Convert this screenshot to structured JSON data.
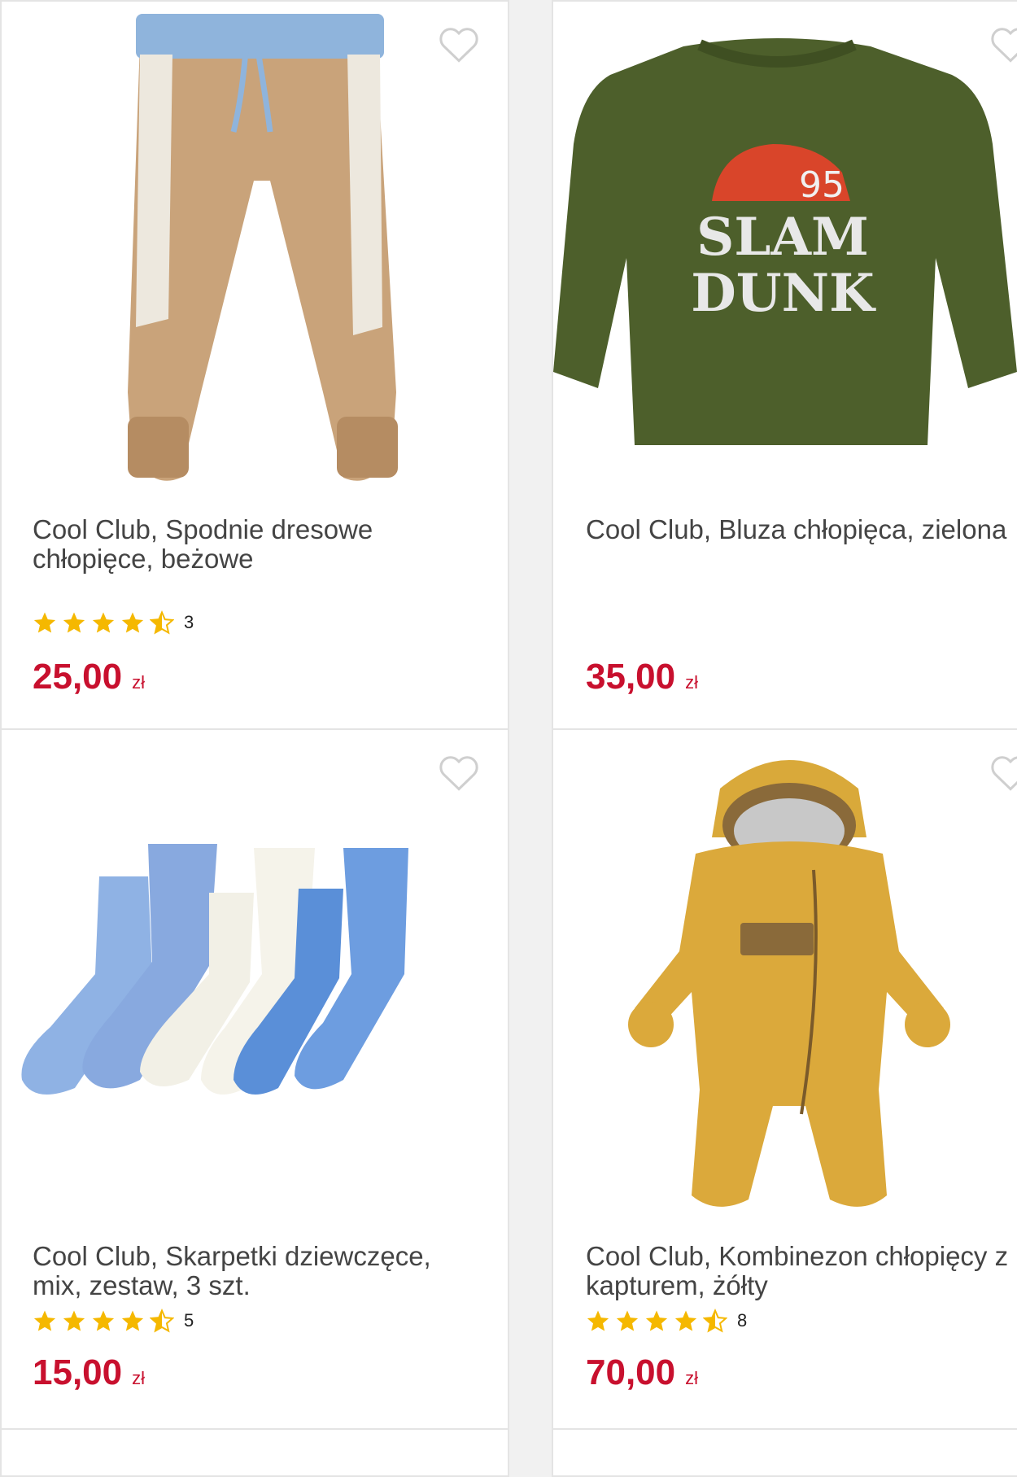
{
  "products": [
    {
      "title": "Cool Club, Spodnie dresowe chłopięce, beżowe",
      "rating": 4.5,
      "rating_count": "3",
      "price": "25,00",
      "currency": "zł",
      "image": "beige-pants"
    },
    {
      "title": "Cool Club, Bluza chłopięca, zielona",
      "price": "35,00",
      "currency": "zł",
      "image": "green-sweatshirt",
      "print_number": "95",
      "print_line1": "SLAM",
      "print_line2": "DUNK"
    },
    {
      "title": "Cool Club, Skarpetki dziewczęce, mix, zestaw, 3 szt.",
      "rating": 4.5,
      "rating_count": "5",
      "price": "15,00",
      "currency": "zł",
      "image": "socks-set"
    },
    {
      "title": "Cool Club, Kombinezon chłopięcy z kapturem, żółty",
      "rating": 4.5,
      "rating_count": "8",
      "price": "70,00",
      "currency": "zł",
      "image": "yellow-snowsuit"
    }
  ],
  "colors": {
    "price": "#c8102e",
    "star": "#f5b800",
    "card_border": "#e4e4e4"
  },
  "icons": [
    "heart-outline-icon",
    "star-icon",
    "star-half-icon"
  ]
}
